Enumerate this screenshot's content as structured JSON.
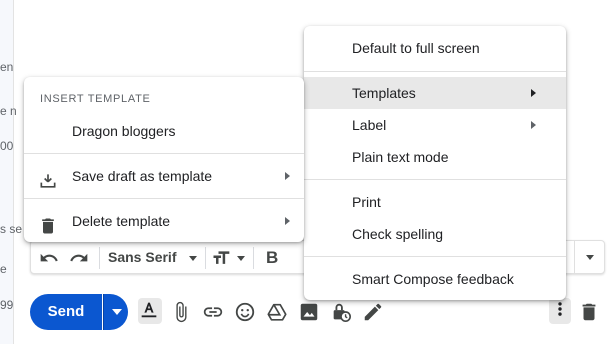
{
  "background": {
    "fragments": [
      "en",
      "e n",
      "00",
      "s se",
      "e",
      "99"
    ]
  },
  "more_options_menu": {
    "items": [
      {
        "label": "Default to full screen"
      },
      {
        "label": "Templates"
      },
      {
        "label": "Label"
      },
      {
        "label": "Plain text mode"
      },
      {
        "label": "Print"
      },
      {
        "label": "Check spelling"
      },
      {
        "label": "Smart Compose feedback"
      }
    ]
  },
  "templates_submenu": {
    "header": "INSERT TEMPLATE",
    "items": [
      {
        "label": "Dragon bloggers"
      },
      {
        "label": "Save draft as template",
        "icon": "download-icon"
      },
      {
        "label": "Delete template",
        "icon": "trash-icon"
      }
    ]
  },
  "format_toolbar": {
    "font": "Sans Serif",
    "bold": "B"
  },
  "compose_toolbar": {
    "send_label": "Send"
  },
  "colors": {
    "accent": "#0b57d0",
    "highlight": "#e8e8e8"
  }
}
